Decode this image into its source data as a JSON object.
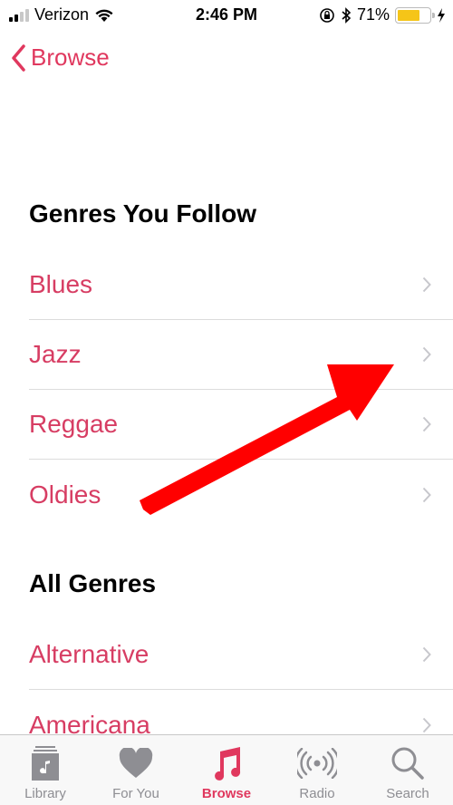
{
  "status_bar": {
    "carrier": "Verizon",
    "time": "2:46 PM",
    "battery_percent_label": "71%",
    "battery_level": 0.71,
    "battery_color": "#f5c518",
    "icons": [
      "signal-icon",
      "wifi-icon",
      "rotation-lock-icon",
      "bluetooth-icon",
      "battery-icon",
      "charging-bolt-icon"
    ]
  },
  "nav": {
    "back_label": "Browse"
  },
  "sections": [
    {
      "title": "Genres You Follow",
      "items": [
        {
          "label": "Blues"
        },
        {
          "label": "Jazz"
        },
        {
          "label": "Reggae"
        },
        {
          "label": "Oldies"
        }
      ]
    },
    {
      "title": "All Genres",
      "items": [
        {
          "label": "Alternative"
        },
        {
          "label": "Americana"
        }
      ]
    }
  ],
  "tabbar": {
    "tabs": [
      {
        "label": "Library",
        "icon": "library-icon"
      },
      {
        "label": "For You",
        "icon": "heart-icon"
      },
      {
        "label": "Browse",
        "icon": "music-note-icon",
        "active": true
      },
      {
        "label": "Radio",
        "icon": "radio-icon"
      },
      {
        "label": "Search",
        "icon": "search-icon"
      }
    ]
  },
  "colors": {
    "accent": "#e0385e",
    "list_text": "#d73d63",
    "inactive_tab": "#8e8e93",
    "annotation_arrow": "#ff0000"
  }
}
